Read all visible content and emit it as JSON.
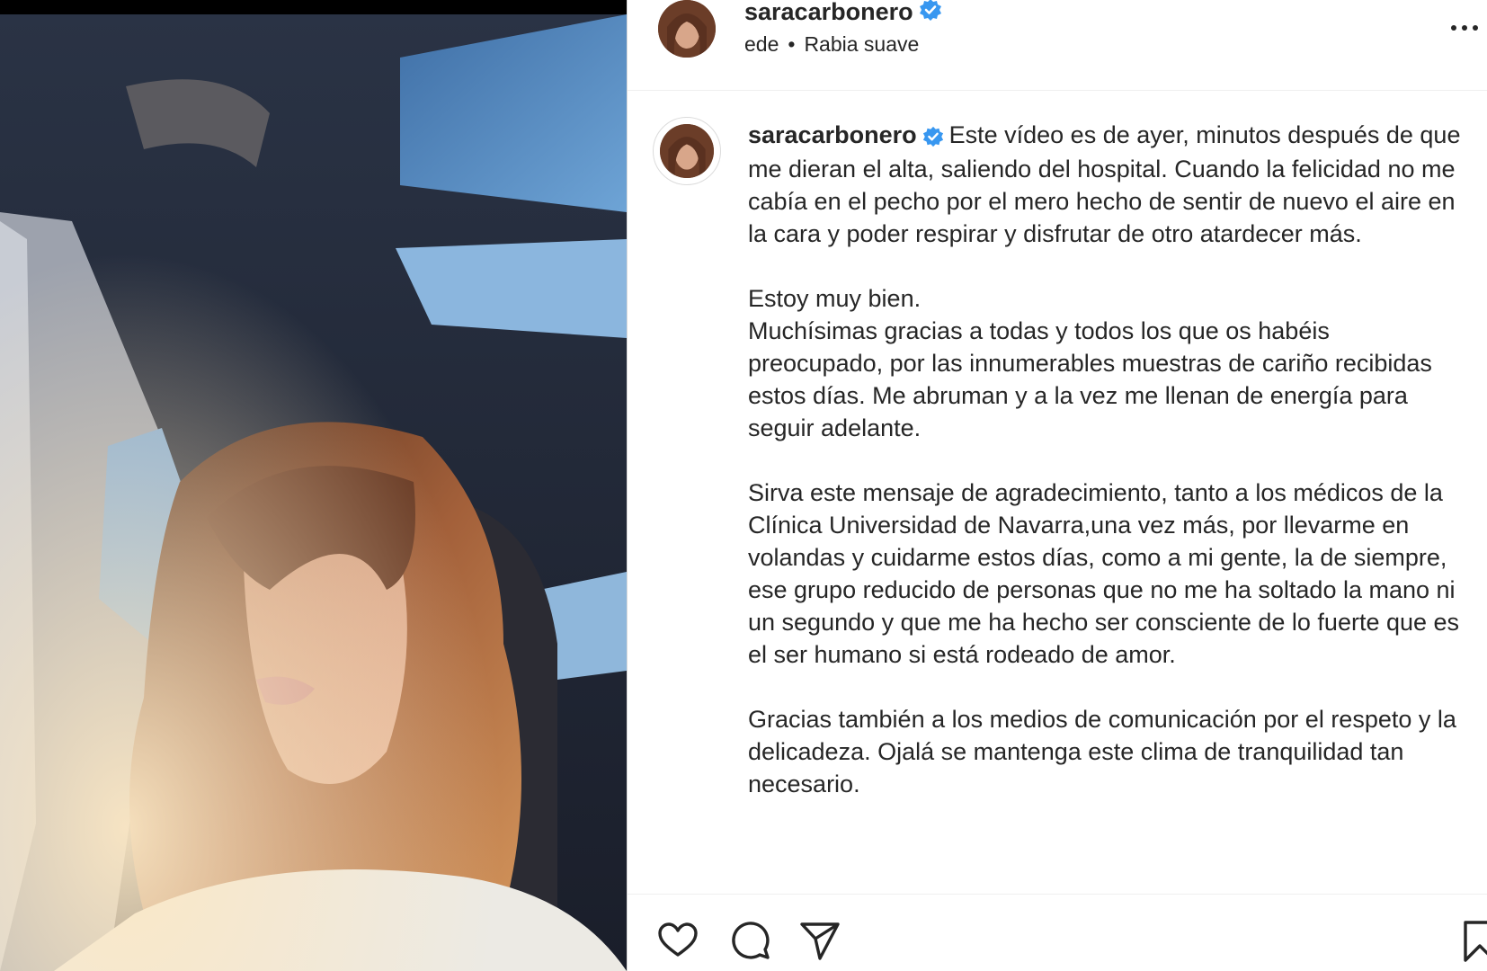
{
  "header": {
    "username": "saracarbonero",
    "verified": true,
    "audio_prefix": "ede",
    "audio_title": "Rabia suave",
    "more_icon": "more-horizontal-icon"
  },
  "caption": {
    "username": "saracarbonero",
    "paragraphs": [
      "Este vídeo es de ayer, minutos después de que me dieran el alta, saliendo del hospital. Cuando la felicidad no me cabía en el pecho por el mero hecho de sentir de nuevo el aire en la cara y poder respirar y disfrutar de otro atardecer más.",
      "Estoy muy bien.",
      "Muchísimas gracias a todas y todos los que os habéis preocupado, por las innumerables muestras de cariño recibidas estos días. Me abruman y a la vez me llenan de energía para seguir adelante.",
      "Sirva este mensaje de agradecimiento, tanto a los médicos de la Clínica Universidad de Navarra,una vez más, por llevarme en volandas y cuidarme estos días, como a mi gente, la de siempre, ese grupo reducido de personas que no me ha soltado la mano ni un segundo y que me ha hecho ser consciente de lo fuerte que es el ser humano si está rodeado de amor.",
      "Gracias también a los medios de comunicación por el respeto y la delicadeza. Ojalá se mantenga este clima de tranquilidad tan necesario."
    ]
  },
  "actions": {
    "like_icon": "heart-icon",
    "comment_icon": "comment-icon",
    "share_icon": "share-icon",
    "save_icon": "bookmark-icon"
  },
  "colors": {
    "verified_badge": "#3897f0",
    "text": "#262626",
    "divider": "#efefef"
  }
}
